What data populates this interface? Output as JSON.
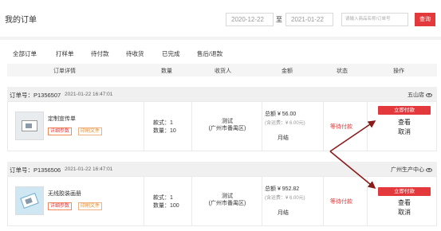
{
  "header": {
    "title": "我的订单",
    "date_from": "2020-12-22",
    "to_label": "至",
    "date_to": "2021-01-22",
    "search_placeholder": "请输入商品名称/订单号",
    "query_label": "查询"
  },
  "tabs": [
    "全部订单",
    "打样单",
    "待付款",
    "待收货",
    "已完成",
    "售后/退款"
  ],
  "table_headers": [
    "订单详情",
    "数量",
    "收货人",
    "金额",
    "状态",
    "操作"
  ],
  "orders": [
    {
      "order_no": "订单号：P1356507",
      "time": "2021-01-22 16:47:01",
      "store": "五山店",
      "product": "定制宣传单",
      "tag_params": "详细参数",
      "tag_print": "印刷文件",
      "styles": "款式：1",
      "quantity": "数量：10",
      "receiver_name": "测试",
      "receiver_area": "(广州市番禺区)",
      "total": "总额 ¥ 56.00",
      "freight": "(含运费：¥ 6.00元)",
      "pay_type": "月结",
      "status": "等待付款",
      "pay_label": "立即付款",
      "view_label": "查看",
      "cancel_label": "取消"
    },
    {
      "order_no": "订单号：P1356506",
      "time": "2021-01-22 16:47:01",
      "store": "广州生产中心",
      "product": "无线胶装画册",
      "tag_params": "详细参数",
      "tag_print": "印刷文件",
      "styles": "款式：1",
      "quantity": "数量：100",
      "receiver_name": "测试",
      "receiver_area": "(广州市番禺区)",
      "total": "总额 ¥ 952.82",
      "freight": "(含运费：¥ 6.00元)",
      "pay_type": "月结",
      "status": "等待付款",
      "pay_label": "立即付款",
      "view_label": "查看",
      "cancel_label": "取消"
    }
  ],
  "colors": {
    "accent": "#e4393c",
    "annotation_arrow": "#8b1a1a"
  }
}
